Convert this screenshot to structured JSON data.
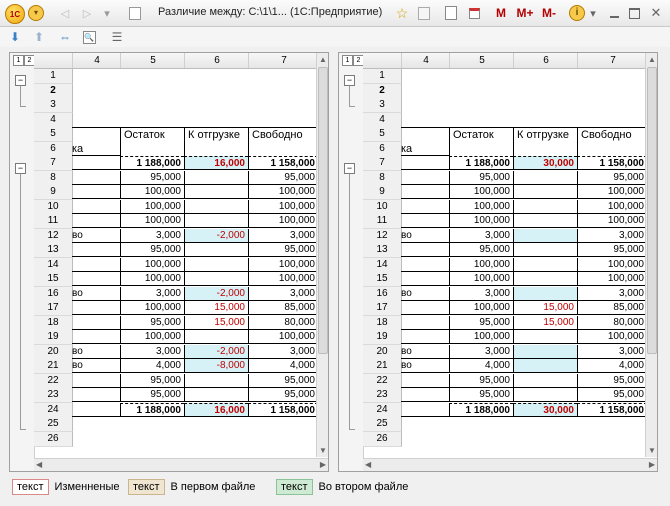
{
  "window": {
    "title": "Различие между: C:\\1\\1...  (1С:Предприятие)"
  },
  "titlebar_buttons": {
    "m": "M",
    "mplus": "M+",
    "mminus": "M-",
    "info": "i"
  },
  "logo_text": "1С",
  "columns": [
    "4",
    "5",
    "6",
    "7"
  ],
  "rows": [
    "1",
    "2",
    "3",
    "4",
    "5",
    "6",
    "7",
    "8",
    "9",
    "10",
    "11",
    "12",
    "13",
    "14",
    "15",
    "16",
    "17",
    "18",
    "19",
    "20",
    "21",
    "22",
    "23",
    "24",
    "25",
    "26"
  ],
  "table_headers": {
    "ostatok": "Остаток",
    "k_otgruzke": "К отгрузке",
    "svobodno": "Свободно",
    "fragment": "ка"
  },
  "row_fragment": "во",
  "left": {
    "data": [
      {
        "r": 7,
        "a": "1 188,000",
        "b": "16,000",
        "c": "1 158,000"
      },
      {
        "r": 8,
        "a": "95,000",
        "b": "",
        "c": "95,000"
      },
      {
        "r": 9,
        "a": "100,000",
        "b": "",
        "c": "100,000"
      },
      {
        "r": 10,
        "a": "100,000",
        "b": "",
        "c": "100,000"
      },
      {
        "r": 11,
        "a": "100,000",
        "b": "",
        "c": "100,000"
      },
      {
        "r": 12,
        "a": "3,000",
        "b": "-2,000",
        "c": "3,000"
      },
      {
        "r": 13,
        "a": "95,000",
        "b": "",
        "c": "95,000"
      },
      {
        "r": 14,
        "a": "100,000",
        "b": "",
        "c": "100,000"
      },
      {
        "r": 15,
        "a": "100,000",
        "b": "",
        "c": "100,000"
      },
      {
        "r": 16,
        "a": "3,000",
        "b": "-2,000",
        "c": "3,000"
      },
      {
        "r": 17,
        "a": "100,000",
        "b": "15,000",
        "c": "85,000"
      },
      {
        "r": 18,
        "a": "95,000",
        "b": "15,000",
        "c": "80,000"
      },
      {
        "r": 19,
        "a": "100,000",
        "b": "",
        "c": "100,000"
      },
      {
        "r": 20,
        "a": "3,000",
        "b": "-2,000",
        "c": "3,000"
      },
      {
        "r": 21,
        "a": "4,000",
        "b": "-8,000",
        "c": "4,000"
      },
      {
        "r": 22,
        "a": "95,000",
        "b": "",
        "c": "95,000"
      },
      {
        "r": 23,
        "a": "95,000",
        "b": "",
        "c": "95,000"
      },
      {
        "r": 24,
        "a": "1 188,000",
        "b": "16,000",
        "c": "1 158,000"
      }
    ]
  },
  "right": {
    "data": [
      {
        "r": 7,
        "a": "1 188,000",
        "b": "30,000",
        "c": "1 158,000"
      },
      {
        "r": 8,
        "a": "95,000",
        "b": "",
        "c": "95,000"
      },
      {
        "r": 9,
        "a": "100,000",
        "b": "",
        "c": "100,000"
      },
      {
        "r": 10,
        "a": "100,000",
        "b": "",
        "c": "100,000"
      },
      {
        "r": 11,
        "a": "100,000",
        "b": "",
        "c": "100,000"
      },
      {
        "r": 12,
        "a": "3,000",
        "b": "",
        "c": "3,000"
      },
      {
        "r": 13,
        "a": "95,000",
        "b": "",
        "c": "95,000"
      },
      {
        "r": 14,
        "a": "100,000",
        "b": "",
        "c": "100,000"
      },
      {
        "r": 15,
        "a": "100,000",
        "b": "",
        "c": "100,000"
      },
      {
        "r": 16,
        "a": "3,000",
        "b": "",
        "c": "3,000"
      },
      {
        "r": 17,
        "a": "100,000",
        "b": "15,000",
        "c": "85,000"
      },
      {
        "r": 18,
        "a": "95,000",
        "b": "15,000",
        "c": "80,000"
      },
      {
        "r": 19,
        "a": "100,000",
        "b": "",
        "c": "100,000"
      },
      {
        "r": 20,
        "a": "3,000",
        "b": "",
        "c": "3,000"
      },
      {
        "r": 21,
        "a": "4,000",
        "b": "",
        "c": "4,000"
      },
      {
        "r": 22,
        "a": "95,000",
        "b": "",
        "c": "95,000"
      },
      {
        "r": 23,
        "a": "95,000",
        "b": "",
        "c": "95,000"
      },
      {
        "r": 24,
        "a": "1 188,000",
        "b": "30,000",
        "c": "1 158,000"
      }
    ]
  },
  "fragment_rows": [
    12,
    16,
    20,
    21
  ],
  "cyan_rows": [
    7,
    12,
    16,
    20,
    21,
    24
  ],
  "legend": {
    "chip": "текст",
    "changed": "Изменненые",
    "first": "В первом файле",
    "second": "Во втором файле"
  },
  "colors": {
    "changed_chip": "#f3c7c7",
    "first_chip": "#e9dcc3",
    "second_chip": "#bfe3c6",
    "diff_bg": "#d7f2f7",
    "diff_text": "#c00000"
  }
}
